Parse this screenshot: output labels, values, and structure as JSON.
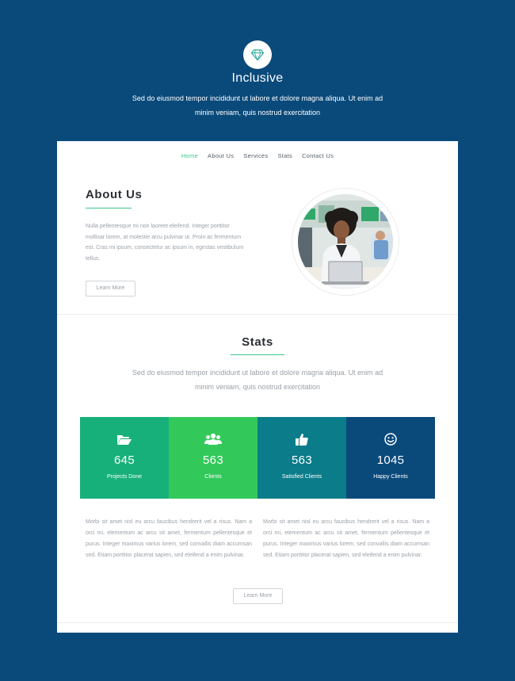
{
  "hero": {
    "icon": "diamond-icon",
    "title": "Inclusive",
    "text": "Sed do eiusmod tempor incididunt ut labore et dolore magna aliqua. Ut enim ad minim veniam, quis nostrud exercitation"
  },
  "nav": {
    "items": [
      {
        "label": "Home",
        "active": true
      },
      {
        "label": "About Us"
      },
      {
        "label": "Services"
      },
      {
        "label": "Stats"
      },
      {
        "label": "Contact Us"
      }
    ]
  },
  "about": {
    "title": "About Us",
    "text": "Nulla pellentesque mi non laoreet eleifend. Integer porttitor mollisar lorem, at molestie arcu pulvinar ut. Proin ac fermentum est. Cras mi ipsum, consectetur ac ipsum in, egestas vestibulum tellus.",
    "button": "Learn More",
    "photo": "woman-with-laptop-photo"
  },
  "stats": {
    "title": "Stats",
    "text": "Sed do eiusmod tempor incididunt ut labore et dolore magna aliqua. Ut enim ad minim veniam, quis nostrud exercitation",
    "tiles": [
      {
        "icon": "folder-open-icon",
        "value": "645",
        "label": "Projects Done",
        "color": "#17b07b"
      },
      {
        "icon": "users-icon",
        "value": "563",
        "label": "Clients",
        "color": "#32c95a"
      },
      {
        "icon": "thumbs-up-icon",
        "value": "563",
        "label": "Satisfied Clients",
        "color": "#0b7c8a"
      },
      {
        "icon": "smile-icon",
        "value": "1045",
        "label": "Happy Clients",
        "color": "#0a4a7b"
      }
    ],
    "col1": "Morbi sit amet nisl eu arcu faucibus hendrerit vel a risus. Nam a orci mi, elementum ac arcu sit amet, fermentum pellentesque et purus. Integer maximus varius lorem, sed convallis diam accumsan sed. Etiam porttitor placerat sapien, sed eleifend a enim pulvinar.",
    "col2": "Morbi sit amet nisl eu arcu faucibus hendrerit vel a risus. Nam a orci mi, elementum ac arcu sit amet, fermentum pellentesque et purus. Integer maximus varius lorem, sed convallis diam accumsan sed. Etiam porttitor placerat sapien, sed eleifend a enim pulvinar.",
    "button": "Learn More"
  },
  "colors": {
    "background": "#0a4a7b",
    "accent": "#3ec58a"
  }
}
